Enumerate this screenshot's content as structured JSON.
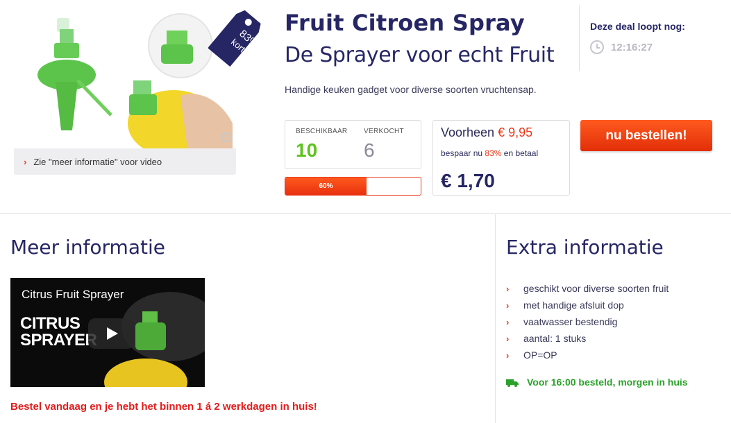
{
  "product": {
    "title": "Fruit Citroen Spray",
    "subtitle": "De Sprayer voor echt Fruit",
    "description": "Handige keuken gadget voor diverse soorten vruchtensap.",
    "info_link": "Zie \"meer informatie\" voor video",
    "discount_tag_pct": "83%",
    "discount_tag_word": "korting"
  },
  "deal": {
    "label": "Deze deal loopt nog:",
    "timer": "12:16:27"
  },
  "stock": {
    "available_label": "BESCHIKBAAR",
    "available_value": "10",
    "sold_label": "VERKOCHT",
    "sold_value": "6",
    "progress_label": "60%",
    "progress_fraction": 0.6
  },
  "price": {
    "was_label": "Voorheen",
    "was_value": "€ 9,95",
    "save_prefix": "bespaar nu",
    "save_pct": "83%",
    "save_suffix": "en betaal",
    "now_value": "€ 1,70"
  },
  "order_button": "nu bestellen!",
  "meer_info": {
    "heading": "Meer informatie",
    "video_title": "Citrus Fruit Sprayer",
    "video_big_line1": "CITRUS",
    "video_big_line2": "SPRAYER",
    "note": "Bestel vandaag en je hebt het binnen 1 á 2 werkdagen in huis!"
  },
  "extra_info": {
    "heading": "Extra informatie",
    "items": [
      "geschikt voor diverse soorten fruit",
      "met handige afsluit dop",
      "vaatwasser bestendig",
      "aantal: 1 stuks",
      "OP=OP"
    ],
    "delivery": "Voor 16:00 besteld, morgen in huis"
  },
  "colors": {
    "accent": "#e8381b",
    "heading": "#262665",
    "green": "#5dc21e",
    "delivery_green": "#2aa22a"
  }
}
